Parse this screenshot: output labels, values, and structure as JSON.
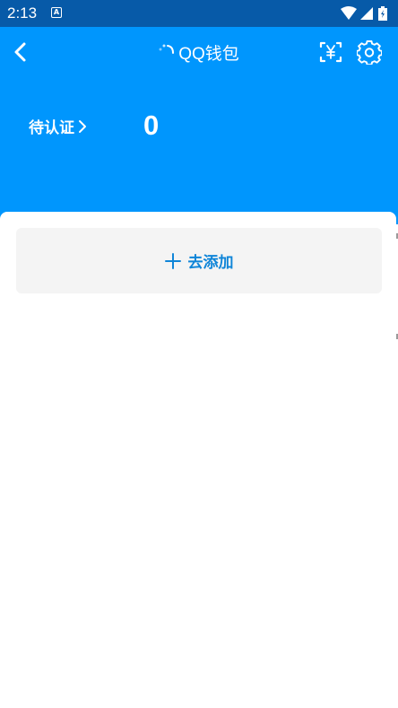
{
  "status_bar": {
    "time": "2:13",
    "notification_glyph": "A",
    "icons": [
      "wifi-icon",
      "signal-icon",
      "battery-icon"
    ]
  },
  "header": {
    "title": "QQ钱包",
    "back_icon": "chevron-left-icon",
    "loading_icon": "loading-spinner-icon",
    "scan_pay_icon": "scan-yuan-icon",
    "settings_icon": "gear-icon"
  },
  "summary": {
    "pending_label": "待认证",
    "pending_count": "0"
  },
  "content": {
    "add_label": "去添加",
    "add_icon": "plus-icon"
  },
  "colors": {
    "status_bar": "#075aa8",
    "header": "#0096fd",
    "accent": "#0f85d8",
    "card": "#ffffff",
    "add_button_bg": "#f4f4f4"
  }
}
